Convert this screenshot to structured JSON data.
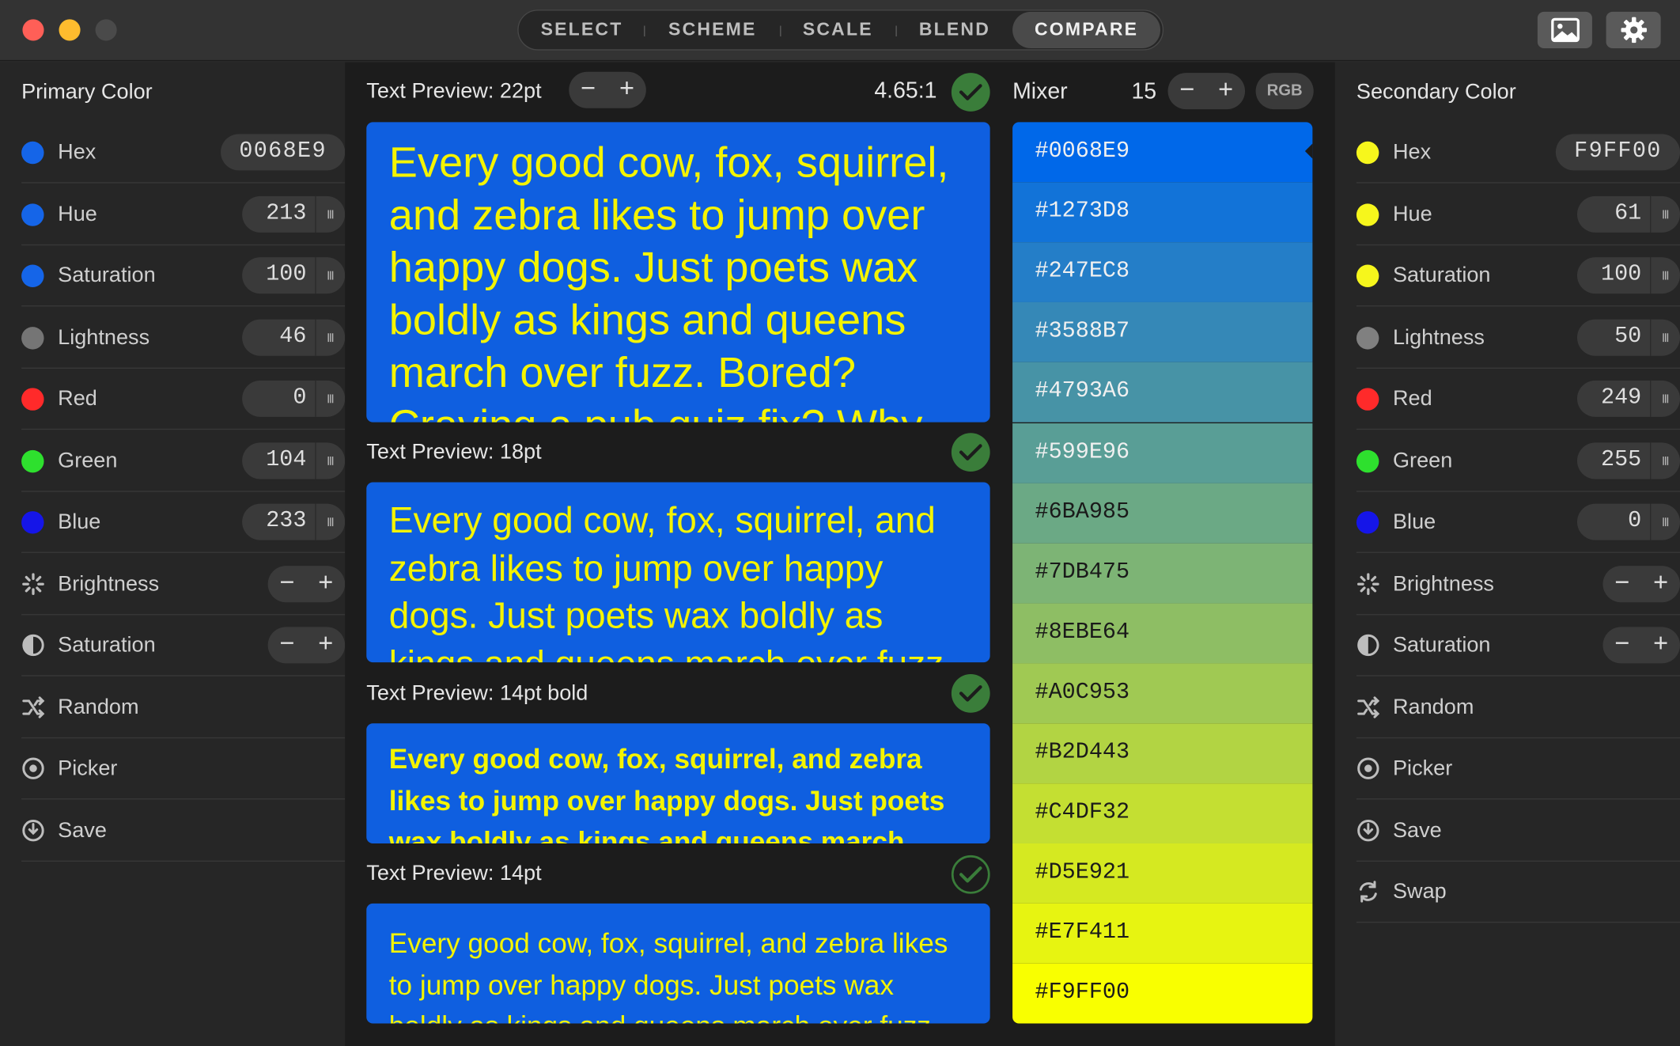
{
  "window": {
    "traffic_lights": [
      "#ff5f57",
      "#febc2e",
      "#4a4a4a"
    ]
  },
  "toolbar": {
    "tabs": [
      "SELECT",
      "SCHEME",
      "SCALE",
      "BLEND",
      "COMPARE"
    ],
    "active_tab": "COMPARE",
    "image_button_icon": "image-icon",
    "settings_button_icon": "gear-icon"
  },
  "primary": {
    "title": "Primary Color",
    "hex_label": "Hex",
    "hex_value": "0068E9",
    "hue_label": "Hue",
    "hue_value": "213",
    "saturation_label": "Saturation",
    "saturation_value": "100",
    "lightness_label": "Lightness",
    "lightness_value": "46",
    "red_label": "Red",
    "red_value": "0",
    "green_label": "Green",
    "green_value": "104",
    "blue_label": "Blue",
    "blue_value": "233",
    "brightness_label": "Brightness",
    "saturation_adjust_label": "Saturation",
    "random_label": "Random",
    "picker_label": "Picker",
    "save_label": "Save",
    "colors": {
      "swatch": "#1565e8",
      "lightness": "#757575",
      "red": "#ff2a2a",
      "green": "#2ee02e",
      "blue": "#1515e8"
    }
  },
  "secondary": {
    "title": "Secondary Color",
    "hex_label": "Hex",
    "hex_value": "F9FF00",
    "hue_label": "Hue",
    "hue_value": "61",
    "saturation_label": "Saturation",
    "saturation_value": "100",
    "lightness_label": "Lightness",
    "lightness_value": "50",
    "red_label": "Red",
    "red_value": "249",
    "green_label": "Green",
    "green_value": "255",
    "blue_label": "Blue",
    "blue_value": "0",
    "brightness_label": "Brightness",
    "saturation_adjust_label": "Saturation",
    "random_label": "Random",
    "picker_label": "Picker",
    "save_label": "Save",
    "swap_label": "Swap",
    "colors": {
      "swatch": "#f6f61c",
      "lightness": "#808080",
      "red": "#ff2a2a",
      "green": "#2ee02e",
      "blue": "#1515e8"
    }
  },
  "preview": {
    "contrast_ratio": "4.65:1",
    "sections": [
      {
        "label": "Text Preview: 22pt",
        "status": "pass",
        "text": "Every good cow, fox, squirrel, and zebra likes to jump over happy dogs. Just poets wax boldly as kings and queens march over fuzz. Bored? Craving a pub quiz fix? Why, just come to the Royal Oak!"
      },
      {
        "label": "Text Preview: 18pt",
        "status": "pass",
        "text": "Every good cow, fox, squirrel, and zebra likes to jump over happy dogs. Just poets wax boldly as kings and queens march over fuzz. Bored? Craving a pub quiz fix?"
      },
      {
        "label": "Text Preview: 14pt bold",
        "status": "pass",
        "text": "Every good cow, fox, squirrel, and zebra likes to jump over happy dogs. Just poets wax boldly as kings and queens march over fuzz."
      },
      {
        "label": "Text Preview: 14pt",
        "status": "pass-outline",
        "text": "Every good cow, fox, squirrel, and zebra likes to jump over happy dogs. Just poets wax boldly as kings and queens march over fuzz."
      }
    ],
    "background": "#0f5fe0",
    "foreground": "#f4f400"
  },
  "mixer": {
    "label": "Mixer",
    "steps": "15",
    "mode": "RGB",
    "swatches": [
      "#0068E9",
      "#1273D8",
      "#247EC8",
      "#3588B7",
      "#4793A6",
      "#599E96",
      "#6BA985",
      "#7DB475",
      "#8EBE64",
      "#A0C953",
      "#B2D443",
      "#C4DF32",
      "#D5E921",
      "#E7F411",
      "#F9FF00"
    ]
  }
}
